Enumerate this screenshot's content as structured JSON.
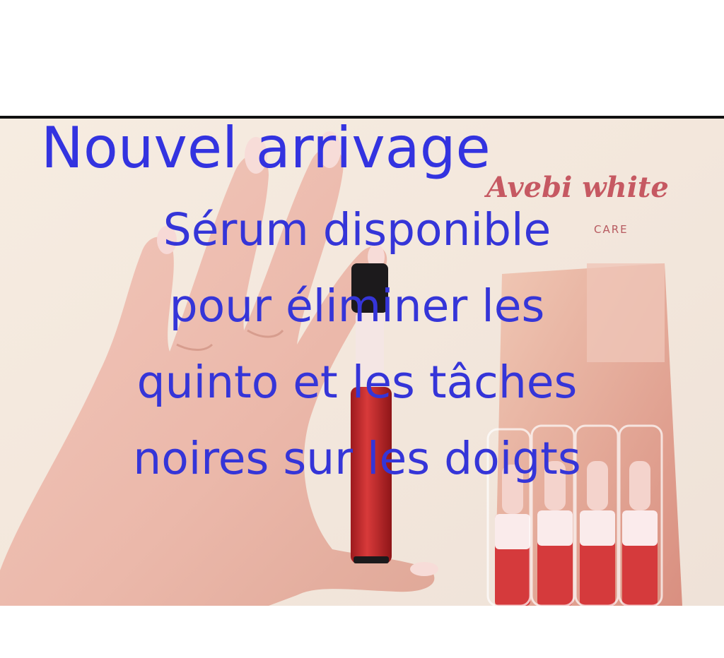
{
  "headline": "Nouvel arrivage",
  "body_lines": [
    "Sérum disponible",
    "pour éliminer les",
    "quinto et les tâches",
    "noires sur les doigts"
  ],
  "brand": {
    "logo": "Avebi white",
    "tagline": "CARE"
  },
  "colors": {
    "text": "#3333e0",
    "brand": "#c24a55"
  }
}
